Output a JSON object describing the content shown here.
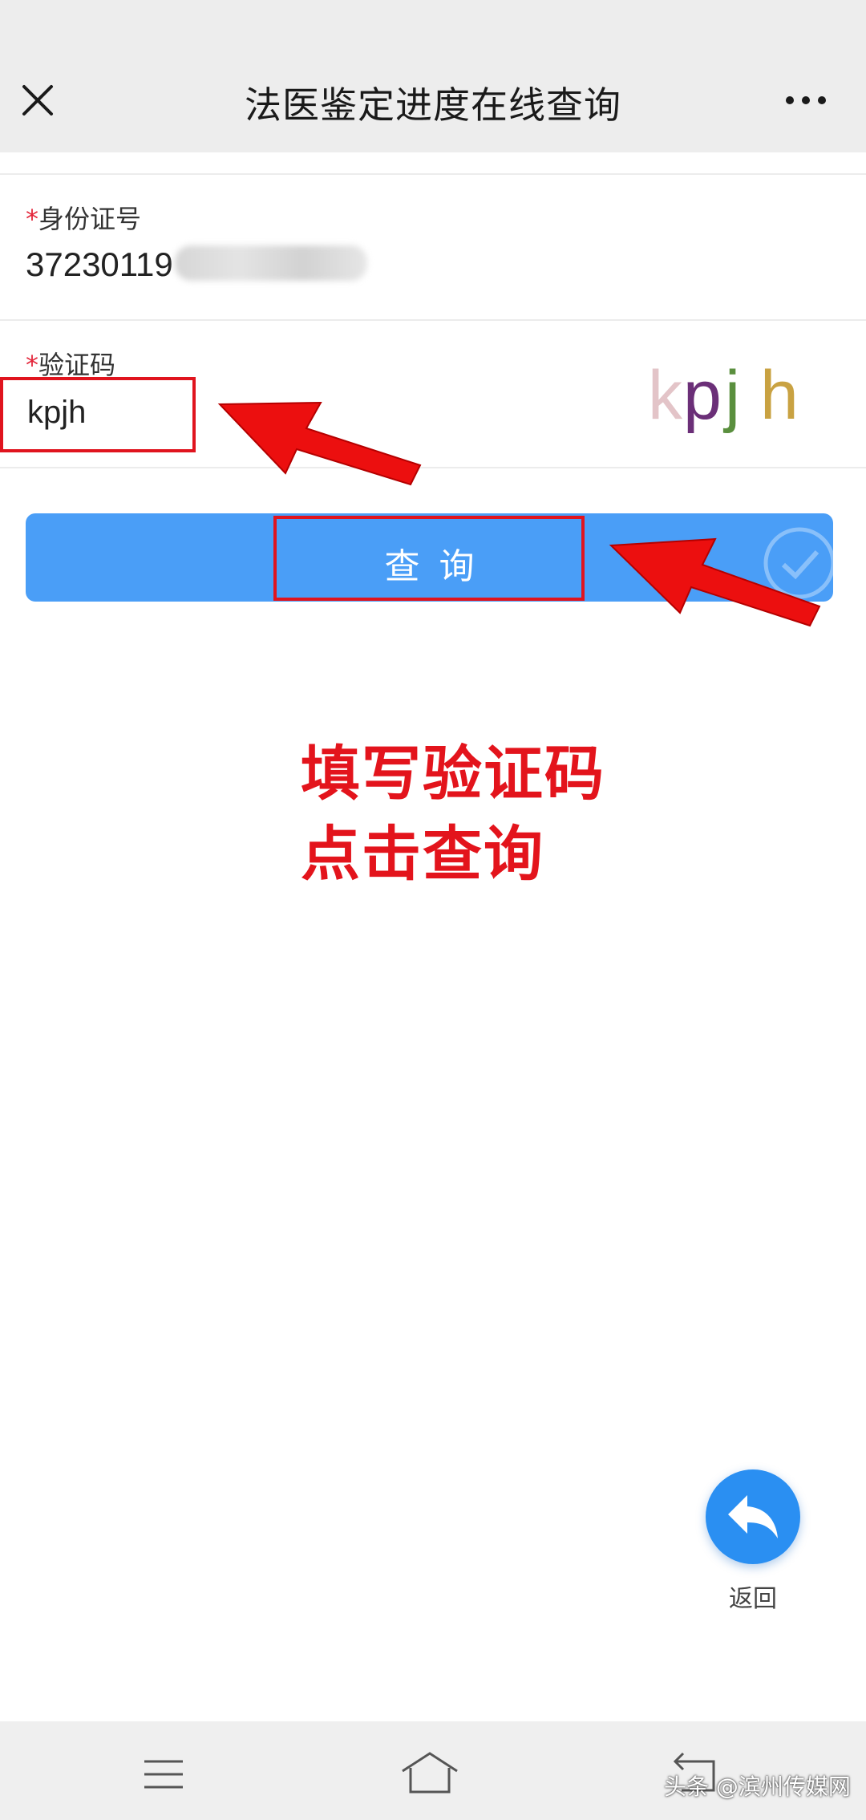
{
  "header": {
    "title": "法医鉴定进度在线查询",
    "close_icon": "close-icon",
    "more_icon": "more-icon"
  },
  "form": {
    "id_field": {
      "required_mark": "*",
      "label": "身份证号",
      "value_visible": "37230119"
    },
    "captcha_field": {
      "required_mark": "*",
      "label": "验证码",
      "value": "kpjh",
      "captcha_image_text": "kpjh"
    },
    "submit_label": "查询"
  },
  "annotation": {
    "line1": "填写验证码",
    "line2": "点击查询",
    "color": "#e3141c"
  },
  "floating": {
    "back_label": "返回",
    "back_icon": "reply-arrow-icon",
    "color": "#2a8ff2"
  },
  "bottom_nav": {
    "icons": [
      "menu-icon",
      "home-icon",
      "back-icon"
    ]
  },
  "watermark": "头条 @滨州传媒网",
  "colors": {
    "accent": "#4a9ef7",
    "required": "#e3263b",
    "highlight": "#e0141e"
  }
}
